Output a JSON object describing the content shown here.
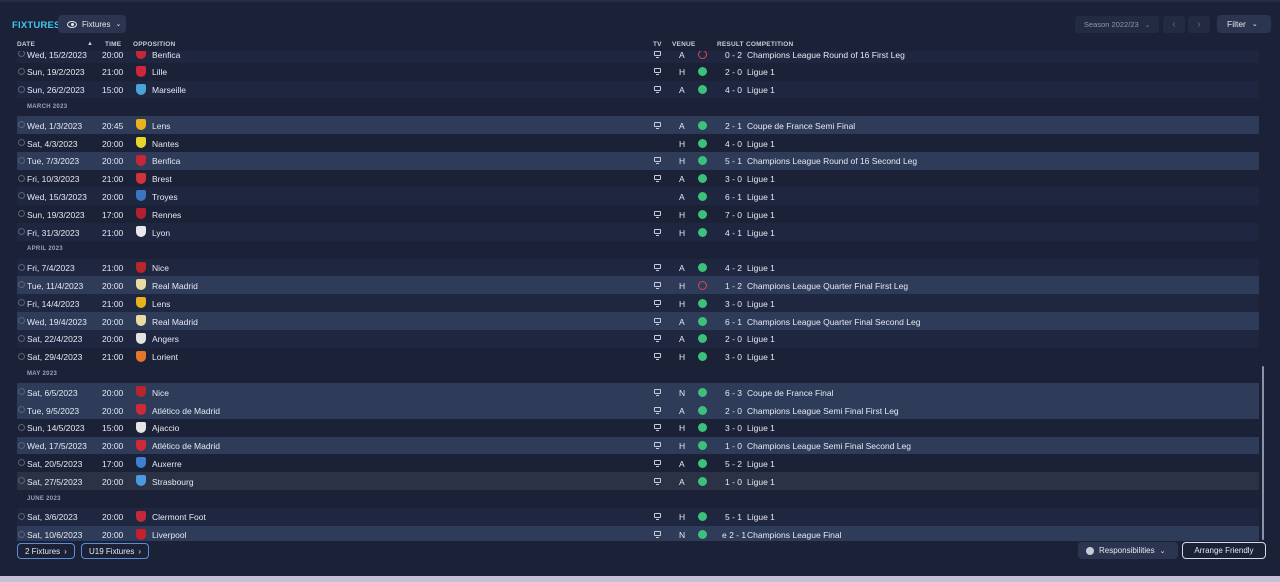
{
  "header": {
    "title": "FIXTURES",
    "view_label": "Fixtures",
    "season_label": "Season 2022/23",
    "filter_label": "Filter"
  },
  "columns": {
    "date": "DATE",
    "time": "TIME",
    "opposition": "OPPOSITION",
    "tv": "TV",
    "venue": "VENUE",
    "result": "RESULT",
    "competition": "COMPETITION"
  },
  "months": [
    "MARCH 2023",
    "APRIL 2023",
    "MAY 2023",
    "JUNE 2023"
  ],
  "fixtures": [
    {
      "date": "Wed, 15/2/2023",
      "time": "20:00",
      "opp": "Benfica",
      "tv": true,
      "venue": "A",
      "outcome": "loss",
      "result": "0 - 2",
      "competition": "Champions League Round of 16 First Leg",
      "crest": "#c6263a"
    },
    {
      "date": "Sun, 19/2/2023",
      "time": "21:00",
      "opp": "Lille",
      "tv": true,
      "venue": "H",
      "outcome": "win",
      "result": "2 - 0",
      "competition": "Ligue 1",
      "crest": "#d0263b"
    },
    {
      "date": "Sun, 26/2/2023",
      "time": "15:00",
      "opp": "Marseille",
      "tv": true,
      "venue": "A",
      "outcome": "win",
      "result": "4 - 0",
      "competition": "Ligue 1",
      "crest": "#4aa3d8"
    },
    {
      "date": "Wed, 1/3/2023",
      "time": "20:45",
      "opp": "Lens",
      "tv": true,
      "venue": "A",
      "outcome": "win",
      "result": "2 - 1",
      "competition": "Coupe de France Semi Final",
      "crest": "#e8b21c"
    },
    {
      "date": "Sat, 4/3/2023",
      "time": "20:00",
      "opp": "Nantes",
      "tv": false,
      "venue": "H",
      "outcome": "win",
      "result": "4 - 0",
      "competition": "Ligue 1",
      "crest": "#e6d62a"
    },
    {
      "date": "Tue, 7/3/2023",
      "time": "20:00",
      "opp": "Benfica",
      "tv": true,
      "venue": "H",
      "outcome": "win",
      "result": "5 - 1",
      "competition": "Champions League Round of 16 Second Leg",
      "crest": "#c6263a"
    },
    {
      "date": "Fri, 10/3/2023",
      "time": "21:00",
      "opp": "Brest",
      "tv": true,
      "venue": "A",
      "outcome": "win",
      "result": "3 - 0",
      "competition": "Ligue 1",
      "crest": "#d4323a"
    },
    {
      "date": "Wed, 15/3/2023",
      "time": "20:00",
      "opp": "Troyes",
      "tv": false,
      "venue": "A",
      "outcome": "win",
      "result": "6 - 1",
      "competition": "Ligue 1",
      "crest": "#3a74c2"
    },
    {
      "date": "Sun, 19/3/2023",
      "time": "17:00",
      "opp": "Rennes",
      "tv": true,
      "venue": "H",
      "outcome": "win",
      "result": "7 - 0",
      "competition": "Ligue 1",
      "crest": "#b5202e"
    },
    {
      "date": "Fri, 31/3/2023",
      "time": "21:00",
      "opp": "Lyon",
      "tv": true,
      "venue": "H",
      "outcome": "win",
      "result": "4 - 1",
      "competition": "Ligue 1",
      "crest": "#e8e8ee"
    },
    {
      "date": "Fri, 7/4/2023",
      "time": "21:00",
      "opp": "Nice",
      "tv": true,
      "venue": "A",
      "outcome": "win",
      "result": "4 - 2",
      "competition": "Ligue 1",
      "crest": "#b8262c"
    },
    {
      "date": "Tue, 11/4/2023",
      "time": "20:00",
      "opp": "Real Madrid",
      "tv": true,
      "venue": "H",
      "outcome": "loss",
      "result": "1 - 2",
      "competition": "Champions League Quarter Final First Leg",
      "crest": "#e9dca0"
    },
    {
      "date": "Fri, 14/4/2023",
      "time": "21:00",
      "opp": "Lens",
      "tv": true,
      "venue": "H",
      "outcome": "win",
      "result": "3 - 0",
      "competition": "Ligue 1",
      "crest": "#e8b21c"
    },
    {
      "date": "Wed, 19/4/2023",
      "time": "20:00",
      "opp": "Real Madrid",
      "tv": true,
      "venue": "A",
      "outcome": "win",
      "result": "6 - 1",
      "competition": "Champions League Quarter Final Second Leg",
      "crest": "#e9dca0"
    },
    {
      "date": "Sat, 22/4/2023",
      "time": "20:00",
      "opp": "Angers",
      "tv": true,
      "venue": "A",
      "outcome": "win",
      "result": "2 - 0",
      "competition": "Ligue 1",
      "crest": "#e2e2e2"
    },
    {
      "date": "Sat, 29/4/2023",
      "time": "21:00",
      "opp": "Lorient",
      "tv": true,
      "venue": "H",
      "outcome": "win",
      "result": "3 - 0",
      "competition": "Ligue 1",
      "crest": "#e2762a"
    },
    {
      "date": "Sat, 6/5/2023",
      "time": "20:00",
      "opp": "Nice",
      "tv": true,
      "venue": "N",
      "outcome": "win",
      "result": "6 - 3",
      "competition": "Coupe de France Final",
      "crest": "#b8262c"
    },
    {
      "date": "Tue, 9/5/2023",
      "time": "20:00",
      "opp": "Atlético de Madrid",
      "tv": true,
      "venue": "A",
      "outcome": "win",
      "result": "2 - 0",
      "competition": "Champions League Semi Final First Leg",
      "crest": "#d02a38"
    },
    {
      "date": "Sun, 14/5/2023",
      "time": "15:00",
      "opp": "Ajaccio",
      "tv": true,
      "venue": "H",
      "outcome": "win",
      "result": "3 - 0",
      "competition": "Ligue 1",
      "crest": "#e4e4e4"
    },
    {
      "date": "Wed, 17/5/2023",
      "time": "20:00",
      "opp": "Atlético de Madrid",
      "tv": true,
      "venue": "H",
      "outcome": "win",
      "result": "1 - 0",
      "competition": "Champions League Semi Final Second Leg",
      "crest": "#d02a38"
    },
    {
      "date": "Sat, 20/5/2023",
      "time": "17:00",
      "opp": "Auxerre",
      "tv": true,
      "venue": "A",
      "outcome": "win",
      "result": "5 - 2",
      "competition": "Ligue 1",
      "crest": "#3d7fd0"
    },
    {
      "date": "Sat, 27/5/2023",
      "time": "20:00",
      "opp": "Strasbourg",
      "tv": true,
      "venue": "A",
      "outcome": "win",
      "result": "1 - 0",
      "competition": "Ligue 1",
      "crest": "#4a9ae0"
    },
    {
      "date": "Sat, 3/6/2023",
      "time": "20:00",
      "opp": "Clermont Foot",
      "tv": true,
      "venue": "H",
      "outcome": "win",
      "result": "5 - 1",
      "competition": "Ligue 1",
      "crest": "#c22a3c"
    },
    {
      "date": "Sat, 10/6/2023",
      "time": "20:00",
      "opp": "Liverpool",
      "tv": true,
      "venue": "N",
      "outcome": "win",
      "result": "e 2 - 1",
      "competition": "Champions League Final",
      "crest": "#c6202c"
    }
  ],
  "footer": {
    "fixtures_link": "2 Fixtures",
    "u19_link": "U19 Fixtures",
    "responsibilities_label": "Responsibilities",
    "arrange_label": "Arrange Friendly"
  }
}
